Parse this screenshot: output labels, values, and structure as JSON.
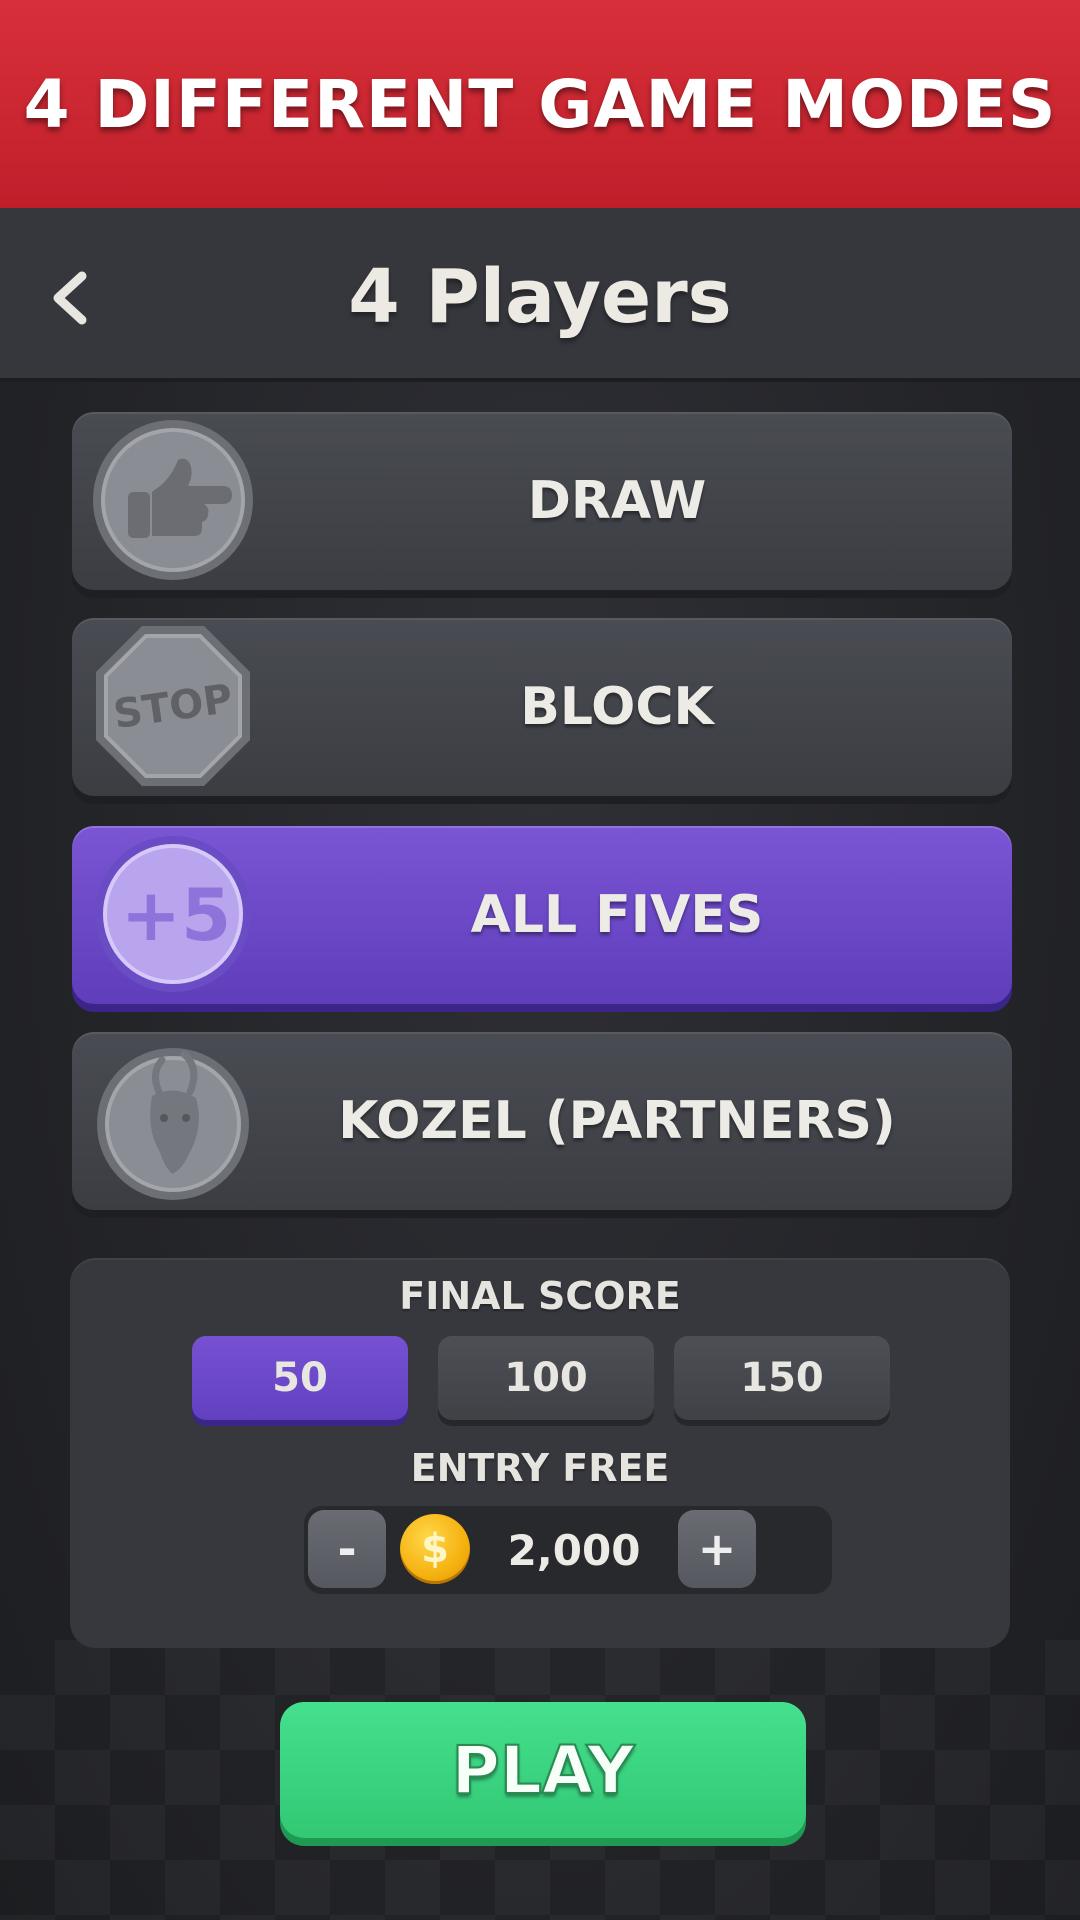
{
  "banner": {
    "text": "4 DIFFERENT GAME MODES"
  },
  "header": {
    "title": "4 Players",
    "back_icon": "chevron-left-icon"
  },
  "modes": [
    {
      "label": "DRAW",
      "icon": "pointing-hand-icon",
      "selected": false
    },
    {
      "label": "BLOCK",
      "icon": "stop-sign-icon",
      "selected": false
    },
    {
      "label": "ALL FIVES",
      "icon": "plus-five-icon",
      "selected": true
    },
    {
      "label": "KOZEL (PARTNERS)",
      "icon": "goat-icon",
      "selected": false
    }
  ],
  "settings": {
    "final_score_label": "FINAL SCORE",
    "score_options": [
      "50",
      "100",
      "150"
    ],
    "selected_score": "50",
    "entry_label": "ENTRY FREE",
    "entry_value": "2,000",
    "minus_label": "-",
    "plus_label": "+",
    "coin_symbol": "$"
  },
  "play_label": "PLAY",
  "colors": {
    "banner": "#c8252f",
    "selected": "#6b47c9",
    "play": "#3cd681",
    "coin": "#f5b10f"
  }
}
